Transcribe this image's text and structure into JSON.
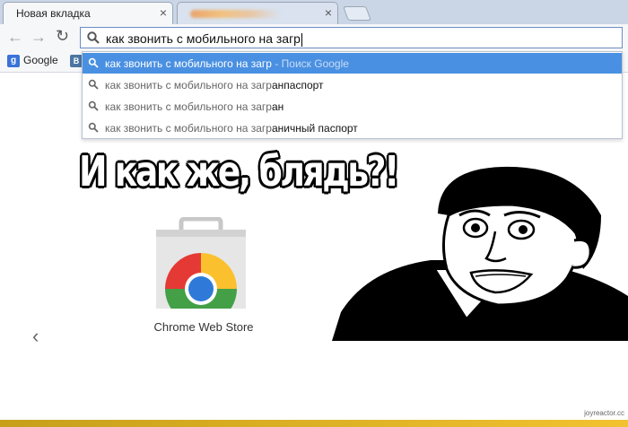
{
  "tabs": [
    {
      "title": "Новая вкладка",
      "close": "×",
      "active": true
    },
    {
      "title": "",
      "close": "×",
      "active": false
    }
  ],
  "toolbar": {
    "back": "←",
    "forward": "→",
    "reload": "↻",
    "omnibox_value": "как звонить с мобильного на загр"
  },
  "bookmarks": [
    {
      "label": "Google",
      "badge": "g"
    },
    {
      "label": "",
      "badge": "B"
    }
  ],
  "suggestions": [
    {
      "prefix": "как звонить с мобильного на загр",
      "completion": "",
      "hint": " - Поиск Google",
      "selected": true
    },
    {
      "prefix": "как звонить с мобильного на загр",
      "completion": "анпаспорт",
      "hint": "",
      "selected": false
    },
    {
      "prefix": "как звонить с мобильного на загр",
      "completion": "ан",
      "hint": "",
      "selected": false
    },
    {
      "prefix": "как звонить с мобильного на загр",
      "completion": "аничный паспорт",
      "hint": "",
      "selected": false
    }
  ],
  "meme": {
    "caption": "И как же, блядь?!"
  },
  "apps": [
    {
      "label": "Chrome Web Store",
      "icon": "chrome-web-store-icon"
    }
  ],
  "pager": {
    "left": "‹"
  },
  "watermark": "joyreactor.cc",
  "colors": {
    "accent": "#4a90e2",
    "tabstrip": "#cad6e6",
    "bottom_strip": "#e5b52a"
  }
}
